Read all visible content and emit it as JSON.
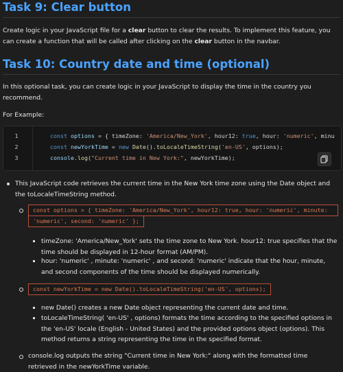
{
  "task9": {
    "title": "Task 9: Clear button",
    "desc_parts": [
      "Create logic in your JavaScript file for a ",
      "clear",
      " button to clear the results. To implement this feature, you can create a function that will be called after clicking on the ",
      "clear",
      " button in the navbar."
    ]
  },
  "task10": {
    "title": "Task 10: Country date and time (optional)",
    "desc": "In this optional task, you can create logic in your JavaScript to display the time in the country you recommend.",
    "example_label": "For Example:"
  },
  "code": {
    "line_numbers": [
      "1",
      "2",
      "3"
    ],
    "line1": {
      "kw": "const",
      "id": "options",
      "rest": " = { timeZone: ",
      "str": "'America/New_York'",
      "rest2": ", hour12: ",
      "kw2": "true",
      "rest3": ", hour: ",
      "str2": "'numeric'",
      "rest4": ", minu"
    },
    "line2": {
      "kw": "const",
      "id": "newYorkTime",
      "rest": " = ",
      "kw2": "new",
      "fn": "Date",
      "rest2": "().",
      "fn2": "toLocaleTimeString",
      "rest3": "(",
      "str": "'en-US'",
      "rest4": ", options);"
    },
    "line3": {
      "id": "console",
      "rest": ".",
      "fn": "log",
      "rest2": "(",
      "str": "\"Current time in New York:\"",
      "rest3": ", newYorkTime);"
    },
    "copy_icon": "copy-icon"
  },
  "explain": {
    "b1": "This JavaScript code retrieves the current time in the New York time zone using the Date object and the toLocaleTimeString method.",
    "code1_line1": "const options = { timeZone: 'America/New_York', hour12: true, hour: 'numeric', minute:",
    "code1_line2": "'numeric', second: 'numeric' };",
    "s1": "timeZone:   'America/New_York'   sets the time zone to New York. hour12: true specifies that the time should be displayed in 12-hour format (AM/PM).",
    "s2": "hour:  'numeric' , minute:  'numeric' , and second:  'numeric'  indicate that the hour, minute, and second components of the time should be displayed numerically.",
    "code2": "const newYorkTime = new Date().toLocaleTimeString('en-US', options);",
    "s3": "new Date() creates a new Date object representing the current date and time.",
    "s4": "toLocaleTimeString(  'en-US'  , options) formats the time according to the specified options in the   'en-US'   locale (English - United States) and the provided options object (options). This method returns a string representing the time in the specified format.",
    "b2": "console.log outputs the string   \"Current time in New York:\"   along with the formatted time retrieved in the newYorkTime variable."
  }
}
